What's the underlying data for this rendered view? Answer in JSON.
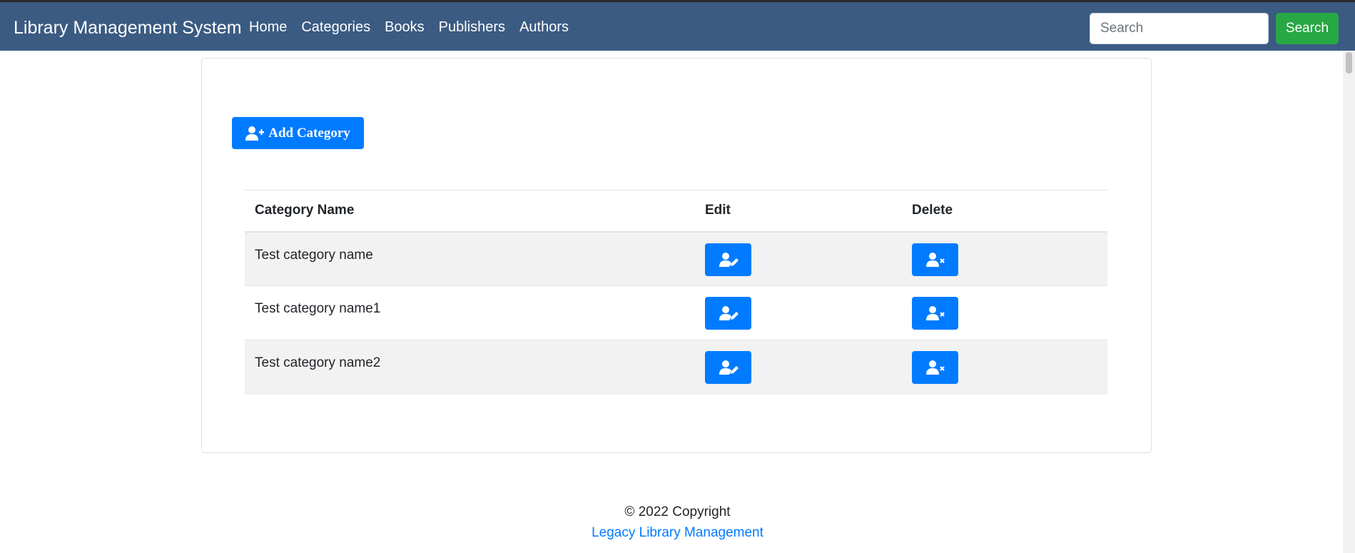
{
  "navbar": {
    "brand": "Library Management System",
    "links": [
      "Home",
      "Categories",
      "Books",
      "Publishers",
      "Authors"
    ],
    "search_placeholder": "Search",
    "search_button": "Search"
  },
  "main": {
    "add_button_label": "Add Category",
    "add_button_icon": "user-plus-icon",
    "table": {
      "headers": [
        "Category Name",
        "Edit",
        "Delete"
      ],
      "rows": [
        {
          "name": "Test category name"
        },
        {
          "name": "Test category name1"
        },
        {
          "name": "Test category name2"
        }
      ],
      "edit_icon": "user-edit-icon",
      "delete_icon": "user-times-icon"
    }
  },
  "footer": {
    "copyright": "© 2022 Copyright",
    "link": "Legacy Library Management"
  },
  "colors": {
    "navbar": "#3b5b82",
    "primary": "#007bff",
    "success": "#28a745",
    "stripe": "#f2f2f2"
  }
}
